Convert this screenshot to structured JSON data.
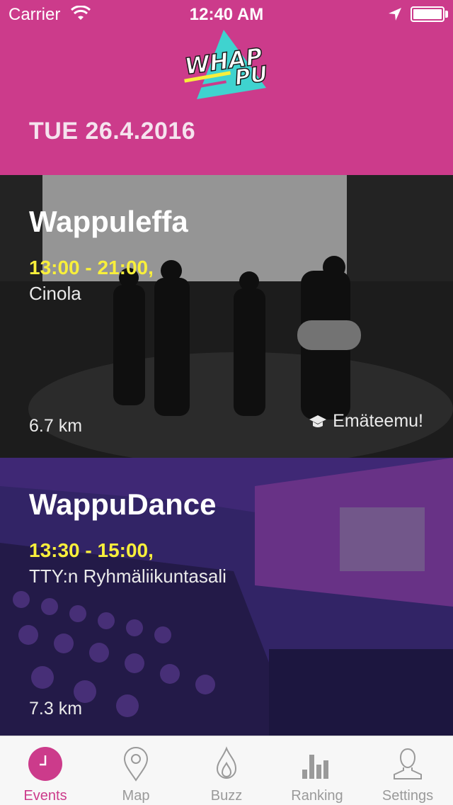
{
  "status_bar": {
    "carrier": "Carrier",
    "time": "12:40 AM"
  },
  "header": {
    "logo_text_top": "WHAP",
    "logo_text_bottom": "PU",
    "date": "TUE 26.4.2016",
    "background_color": "#cc3b8b"
  },
  "events": [
    {
      "title": "Wappuleffa",
      "time": "13:00 - 21:00,",
      "place": "Cinola",
      "distance": "6.7 km",
      "tag": "Emäteemu!",
      "tag_icon": "graduation-cap-icon"
    },
    {
      "title": "WappuDance",
      "time": "13:30 - 15:00,",
      "place": "TTY:n Ryhmäliikuntasali",
      "distance": "7.3 km"
    }
  ],
  "tabbar": {
    "active_color": "#cc3b8b",
    "items": [
      {
        "label": "Events",
        "icon": "clock-icon"
      },
      {
        "label": "Map",
        "icon": "map-pin-icon"
      },
      {
        "label": "Buzz",
        "icon": "flame-icon"
      },
      {
        "label": "Ranking",
        "icon": "bar-chart-icon"
      },
      {
        "label": "Settings",
        "icon": "user-icon"
      }
    ]
  }
}
